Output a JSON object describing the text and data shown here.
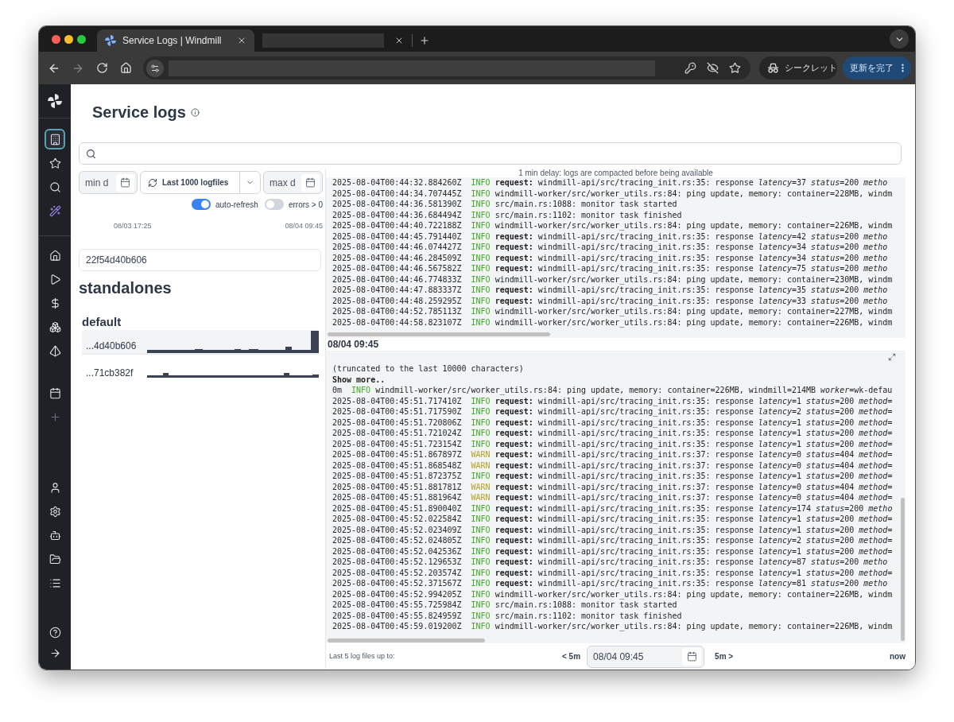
{
  "browser": {
    "tabs": [
      {
        "title": "Service Logs | Windmill",
        "selected": true
      },
      {
        "selected": false
      }
    ],
    "incognito": "シークレット",
    "update_button": "更新を完了"
  },
  "sidebar": {
    "items": [
      {
        "selected": true
      },
      {
        "selected": false
      },
      {
        "selected": false
      },
      {
        "selected": false
      },
      {
        "selected": false
      },
      {
        "selected": false
      },
      {
        "selected": false
      },
      {
        "selected": false
      },
      {
        "selected": false
      },
      {
        "selected": false
      },
      {
        "selected": false
      },
      {
        "selected": false
      },
      {
        "selected": false
      },
      {
        "selected": false
      },
      {
        "selected": false
      },
      {
        "selected": false
      },
      {
        "selected": false
      },
      {
        "selected": false
      }
    ]
  },
  "page": {
    "title": "Service logs"
  },
  "filters": {
    "min_date": {
      "placeholder": "min d"
    },
    "range_button": "Last 1000 logfiles",
    "max_date": {
      "placeholder": "max d"
    },
    "toggles": [
      {
        "label": "auto-refresh",
        "on": true
      },
      {
        "label": "errors > 0",
        "on": false
      }
    ]
  },
  "timeline": {
    "start": "08/03 17:25",
    "end": "08/04 09:45"
  },
  "host": {
    "value": "22f54d40b606"
  },
  "mode": "standalones",
  "worker_group": "default",
  "log_files": [
    {
      "name": "...4d40b606",
      "selected": true
    },
    {
      "name": "...71cb382f",
      "selected": false
    }
  ],
  "notice": "1 min delay: logs are compacted before being available",
  "log_panels": [
    {
      "lines": [
        {
          "time": "2025-08-04T00:44:32.884260Z",
          "level": "INFO",
          "kind": "info",
          "message": "**request:** windmill-api/src/tracing_init.rs:35: response *latency*=37 *status*=200 *metho*"
        },
        {
          "time": "2025-08-04T00:44:34.707445Z",
          "level": "INFO",
          "kind": "info",
          "message": "windmill-worker/src/worker_utils.rs:84: ping update, memory: container=228MB, windm"
        },
        {
          "time": "2025-08-04T00:44:36.581390Z",
          "level": "INFO",
          "kind": "info",
          "message": "src/main.rs:1088: monitor task started"
        },
        {
          "time": "2025-08-04T00:44:36.684494Z",
          "level": "INFO",
          "kind": "info",
          "message": "src/main.rs:1102: monitor task finished"
        },
        {
          "time": "2025-08-04T00:44:40.722188Z",
          "level": "INFO",
          "kind": "info",
          "message": "windmill-worker/src/worker_utils.rs:84: ping update, memory: container=226MB, windm"
        },
        {
          "time": "2025-08-04T00:44:45.791440Z",
          "level": "INFO",
          "kind": "info",
          "message": "**request:** windmill-api/src/tracing_init.rs:35: response *latency*=42 *status*=200 *metho*"
        },
        {
          "time": "2025-08-04T00:44:46.074427Z",
          "level": "INFO",
          "kind": "info",
          "message": "**request:** windmill-api/src/tracing_init.rs:35: response *latency*=34 *status*=200 *metho*"
        },
        {
          "time": "2025-08-04T00:44:46.284509Z",
          "level": "INFO",
          "kind": "info",
          "message": "**request:** windmill-api/src/tracing_init.rs:35: response *latency*=34 *status*=200 *metho*"
        },
        {
          "time": "2025-08-04T00:44:46.567582Z",
          "level": "INFO",
          "kind": "info",
          "message": "**request:** windmill-api/src/tracing_init.rs:35: response *latency*=75 *status*=200 *metho*"
        },
        {
          "time": "2025-08-04T00:44:46.774833Z",
          "level": "INFO",
          "kind": "info",
          "message": "windmill-worker/src/worker_utils.rs:84: ping update, memory: container=230MB, windm"
        },
        {
          "time": "2025-08-04T00:44:47.883337Z",
          "level": "INFO",
          "kind": "info",
          "message": "**request:** windmill-api/src/tracing_init.rs:35: response *latency*=35 *status*=200 *metho*"
        },
        {
          "time": "2025-08-04T00:44:48.259295Z",
          "level": "INFO",
          "kind": "info",
          "message": "**request:** windmill-api/src/tracing_init.rs:35: response *latency*=33 *status*=200 *metho*"
        },
        {
          "time": "2025-08-04T00:44:52.785113Z",
          "level": "INFO",
          "kind": "info",
          "message": "windmill-worker/src/worker_utils.rs:84: ping update, memory: container=227MB, windm"
        },
        {
          "time": "2025-08-04T00:44:58.823107Z",
          "level": "INFO",
          "kind": "info",
          "message": "windmill-worker/src/worker_utils.rs:84: ping update, memory: container=226MB, windm"
        }
      ]
    },
    {
      "header": "08/04 09:45",
      "note": "(truncated to the last 10000 characters)",
      "show_more": "Show more..",
      "lines": [
        {
          "time": "0m",
          "level": "INFO",
          "kind": "info",
          "message": "windmill-worker/src/worker_utils.rs:84: ping update, memory: container=226MB, windmill=214MB *worker*=wk-defau"
        },
        {
          "time": "2025-08-04T00:45:51.717410Z",
          "level": "INFO",
          "kind": "info",
          "message": "**request:** windmill-api/src/tracing_init.rs:35: response *latency*=1 *status*=200 *method*="
        },
        {
          "time": "2025-08-04T00:45:51.717590Z",
          "level": "INFO",
          "kind": "info",
          "message": "**request:** windmill-api/src/tracing_init.rs:35: response *latency*=2 *status*=200 *method*="
        },
        {
          "time": "2025-08-04T00:45:51.720806Z",
          "level": "INFO",
          "kind": "info",
          "message": "**request:** windmill-api/src/tracing_init.rs:35: response *latency*=1 *status*=200 *method*="
        },
        {
          "time": "2025-08-04T00:45:51.721024Z",
          "level": "INFO",
          "kind": "info",
          "message": "**request:** windmill-api/src/tracing_init.rs:35: response *latency*=1 *status*=200 *method*="
        },
        {
          "time": "2025-08-04T00:45:51.723154Z",
          "level": "INFO",
          "kind": "info",
          "message": "**request:** windmill-api/src/tracing_init.rs:35: response *latency*=1 *status*=200 *method*="
        },
        {
          "time": "2025-08-04T00:45:51.867897Z",
          "level": "WARN",
          "kind": "warn",
          "message": "**request:** windmill-api/src/tracing_init.rs:37: response *latency*=0 *status*=404 *method*="
        },
        {
          "time": "2025-08-04T00:45:51.868548Z",
          "level": "WARN",
          "kind": "warn",
          "message": "**request:** windmill-api/src/tracing_init.rs:37: response *latency*=0 *status*=404 *method*="
        },
        {
          "time": "2025-08-04T00:45:51.872375Z",
          "level": "INFO",
          "kind": "info",
          "message": "**request:** windmill-api/src/tracing_init.rs:35: response *latency*=1 *status*=200 *method*="
        },
        {
          "time": "2025-08-04T00:45:51.881781Z",
          "level": "WARN",
          "kind": "warn",
          "message": "**request:** windmill-api/src/tracing_init.rs:37: response *latency*=0 *status*=404 *method*="
        },
        {
          "time": "2025-08-04T00:45:51.881964Z",
          "level": "WARN",
          "kind": "warn",
          "message": "**request:** windmill-api/src/tracing_init.rs:37: response *latency*=0 *status*=404 *method*="
        },
        {
          "time": "2025-08-04T00:45:51.890040Z",
          "level": "INFO",
          "kind": "info",
          "message": "**request:** windmill-api/src/tracing_init.rs:35: response *latency*=174 *status*=200 *metho*"
        },
        {
          "time": "2025-08-04T00:45:52.022584Z",
          "level": "INFO",
          "kind": "info",
          "message": "**request:** windmill-api/src/tracing_init.rs:35: response *latency*=1 *status*=200 *method*="
        },
        {
          "time": "2025-08-04T00:45:52.023409Z",
          "level": "INFO",
          "kind": "info",
          "message": "**request:** windmill-api/src/tracing_init.rs:35: response *latency*=1 *status*=200 *method*="
        },
        {
          "time": "2025-08-04T00:45:52.024805Z",
          "level": "INFO",
          "kind": "info",
          "message": "**request:** windmill-api/src/tracing_init.rs:35: response *latency*=2 *status*=200 *method*="
        },
        {
          "time": "2025-08-04T00:45:52.042536Z",
          "level": "INFO",
          "kind": "info",
          "message": "**request:** windmill-api/src/tracing_init.rs:35: response *latency*=1 *status*=200 *method*="
        },
        {
          "time": "2025-08-04T00:45:52.129653Z",
          "level": "INFO",
          "kind": "info",
          "message": "**request:** windmill-api/src/tracing_init.rs:35: response *latency*=87 *status*=200 *metho*"
        },
        {
          "time": "2025-08-04T00:45:52.203574Z",
          "level": "INFO",
          "kind": "info",
          "message": "**request:** windmill-api/src/tracing_init.rs:35: response *latency*=1 *status*=200 *method*="
        },
        {
          "time": "2025-08-04T00:45:52.371567Z",
          "level": "INFO",
          "kind": "info",
          "message": "**request:** windmill-api/src/tracing_init.rs:35: response *latency*=81 *status*=200 *metho*"
        },
        {
          "time": "2025-08-04T00:45:52.994205Z",
          "level": "INFO",
          "kind": "info",
          "message": "windmill-worker/src/worker_utils.rs:84: ping update, memory: container=226MB, windm"
        },
        {
          "time": "2025-08-04T00:45:55.725984Z",
          "level": "INFO",
          "kind": "info",
          "message": "src/main.rs:1088: monitor task started"
        },
        {
          "time": "2025-08-04T00:45:55.824959Z",
          "level": "INFO",
          "kind": "info",
          "message": "src/main.rs:1102: monitor task finished"
        },
        {
          "time": "2025-08-04T00:45:59.019200Z",
          "level": "INFO",
          "kind": "info",
          "message": "windmill-worker/src/worker_utils.rs:84: ping update, memory: container=226MB, windm"
        }
      ]
    }
  ],
  "footer": {
    "label": "Last 5 log files up to:",
    "prev": "< 5m",
    "date": "08/04 09:45",
    "next": "5m >",
    "now": "now"
  }
}
